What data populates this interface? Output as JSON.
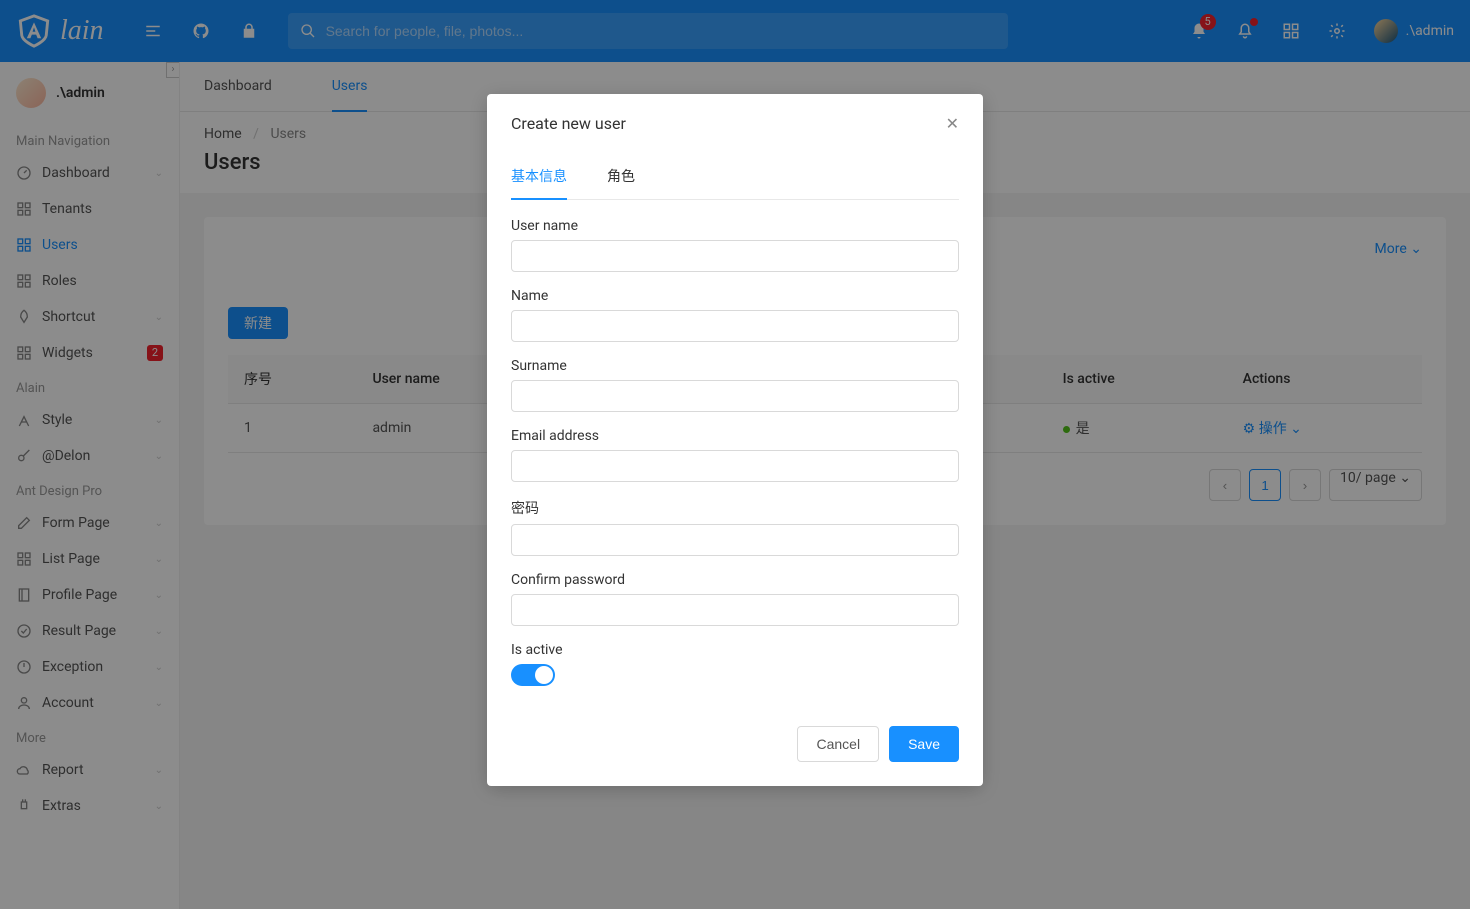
{
  "header": {
    "logo_text": "lain",
    "search_placeholder": "Search for people, file, photos...",
    "notif_count": "5",
    "username": ".\\admin"
  },
  "sidebar": {
    "username": ".\\admin",
    "groups": [
      {
        "title": "Main Navigation"
      },
      {
        "title": "Alain"
      },
      {
        "title": "Ant Design Pro"
      },
      {
        "title": "More"
      }
    ],
    "items": {
      "dashboard": "Dashboard",
      "tenants": "Tenants",
      "users": "Users",
      "roles": "Roles",
      "shortcut": "Shortcut",
      "widgets": "Widgets",
      "widgets_badge": "2",
      "style": "Style",
      "delon": "@Delon",
      "form_page": "Form Page",
      "list_page": "List Page",
      "profile_page": "Profile Page",
      "result_page": "Result Page",
      "exception": "Exception",
      "account": "Account",
      "report": "Report",
      "extras": "Extras"
    }
  },
  "tabs": {
    "dashboard": "Dashboard",
    "users": "Users"
  },
  "breadcrumb": {
    "home": "Home",
    "users": "Users",
    "sep": "/"
  },
  "page": {
    "title": "Users",
    "more": "More",
    "new_btn": "新建"
  },
  "table": {
    "cols": {
      "seq": "序号",
      "username": "User name",
      "active": "Is active",
      "actions": "Actions"
    },
    "rows": [
      {
        "seq": "1",
        "username": "admin",
        "active_text": "是",
        "action_text": "操作"
      }
    ]
  },
  "pagination": {
    "current": "1",
    "page_size": "10/ page"
  },
  "modal": {
    "title": "Create new user",
    "tabs": {
      "basic": "基本信息",
      "roles": "角色"
    },
    "fields": {
      "username": "User name",
      "name": "Name",
      "surname": "Surname",
      "email": "Email address",
      "password": "密码",
      "confirm": "Confirm password",
      "active": "Is active"
    },
    "cancel": "Cancel",
    "save": "Save"
  }
}
